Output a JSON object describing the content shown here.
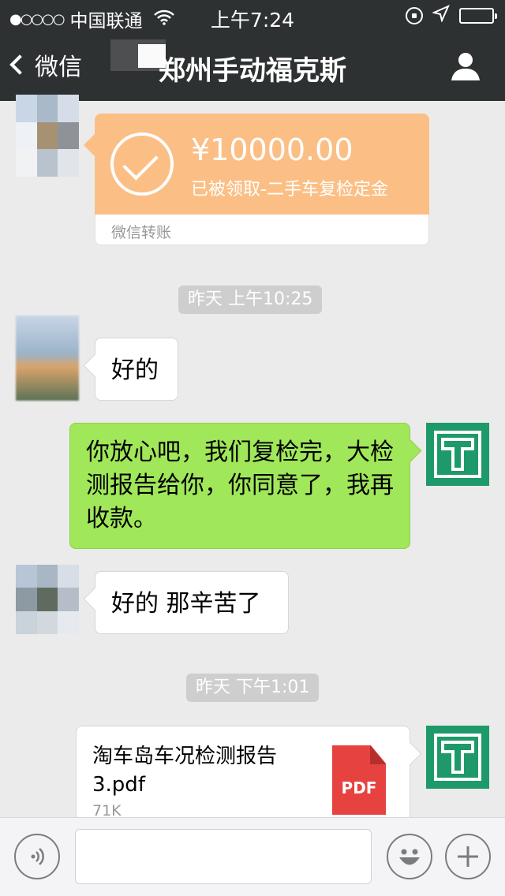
{
  "status_bar": {
    "signal": "●○○○○",
    "carrier": "中国联通",
    "time": "上午7:24"
  },
  "nav": {
    "back_label": "微信",
    "title": "郑州手动福克斯",
    "icons": [
      "chevron-left-icon",
      "person-icon"
    ]
  },
  "messages": {
    "transfer": {
      "amount": "¥10000.00",
      "description": "已被领取-二手车复检定金",
      "footer": "微信转账"
    },
    "time1": "昨天 上午10:25",
    "msg_in_1": "好的",
    "msg_out_1": "你放心吧，我们复检完，大检测报告给你，你同意了，我再收款。",
    "msg_in_2": "好的 那辛苦了",
    "time2": "昨天 下午1:01",
    "file": {
      "name": "淘车岛车况检测报告3.pdf",
      "size": "71K",
      "type_label": "PDF"
    }
  },
  "input_bar": {
    "icons": [
      "voice-icon",
      "emoji-icon",
      "plus-icon"
    ],
    "placeholder": ""
  },
  "colors": {
    "nav_bg": "#2e3132",
    "chat_bg": "#ebebeb",
    "outgoing_bubble": "#a0e75a",
    "transfer_card": "#fbbf86",
    "pdf_red": "#e64340",
    "avatar_green": "#1e9a6a"
  }
}
